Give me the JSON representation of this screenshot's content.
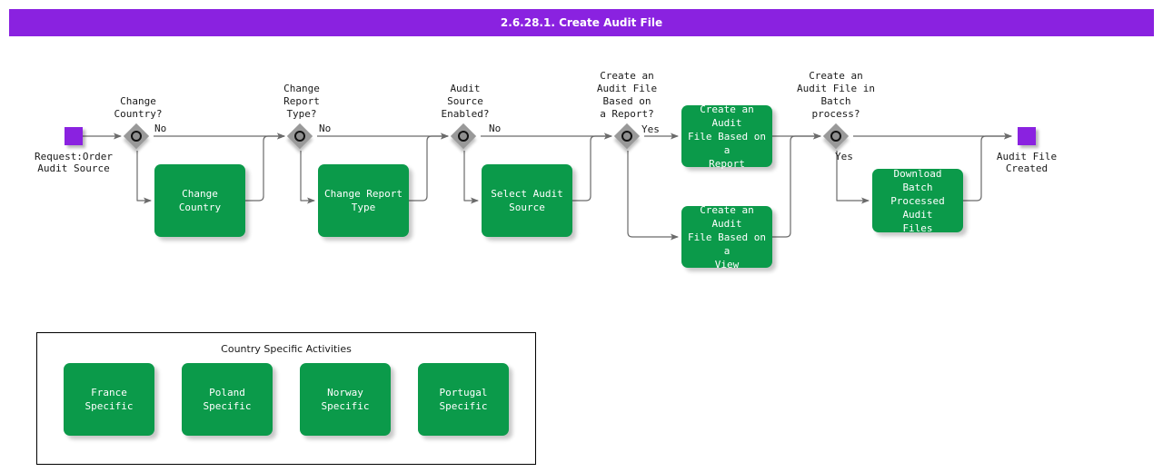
{
  "window": {
    "title": "2.6.28.1. Create Audit File"
  },
  "colors": {
    "banner": "#8a22e0",
    "event": "#8a22e0",
    "task": "#0b9a4a",
    "gateway": "#999999",
    "connector": "#6a6a6a",
    "task_text": "#ffffff"
  },
  "diagram": {
    "start_event": {
      "name": "start-event",
      "label": "Request:Order\nAudit Source"
    },
    "end_event": {
      "name": "end-event",
      "label": "Audit File\nCreated"
    },
    "gateways": [
      {
        "id": "gw-change-country",
        "label": "Change\nCountry?",
        "flow_label": "No"
      },
      {
        "id": "gw-change-report",
        "label": "Change\nReport\nType?",
        "flow_label": "No"
      },
      {
        "id": "gw-audit-source",
        "label": "Audit\nSource\nEnabled?",
        "flow_label": "No"
      },
      {
        "id": "gw-based-on-report",
        "label": "Create an\nAudit File\nBased on\na Report?",
        "flow_label": "Yes"
      },
      {
        "id": "gw-batch-process",
        "label": "Create an\nAudit File in\nBatch\nprocess?",
        "flow_label": "Yes"
      }
    ],
    "tasks": [
      {
        "id": "task-change-country",
        "label": "Change\nCountry"
      },
      {
        "id": "task-change-report-type",
        "label": "Change Report\nType"
      },
      {
        "id": "task-select-audit-source",
        "label": "Select Audit\nSource"
      },
      {
        "id": "task-create-from-report",
        "label": "Create an Audit\nFile Based on a\nReport"
      },
      {
        "id": "task-create-from-view",
        "label": "Create an Audit\nFile Based on a\nView"
      },
      {
        "id": "task-download-batch-files",
        "label": "Download Batch\nProcessed Audit\nFiles"
      }
    ]
  },
  "group": {
    "title": "Country Specific Activities",
    "tasks": [
      {
        "id": "task-france-specific",
        "label": "France Specific"
      },
      {
        "id": "task-poland-specific",
        "label": "Poland Specific"
      },
      {
        "id": "task-norway-specific",
        "label": "Norway Specific"
      },
      {
        "id": "task-portugal-specific",
        "label": "Portugal Specific"
      }
    ]
  }
}
